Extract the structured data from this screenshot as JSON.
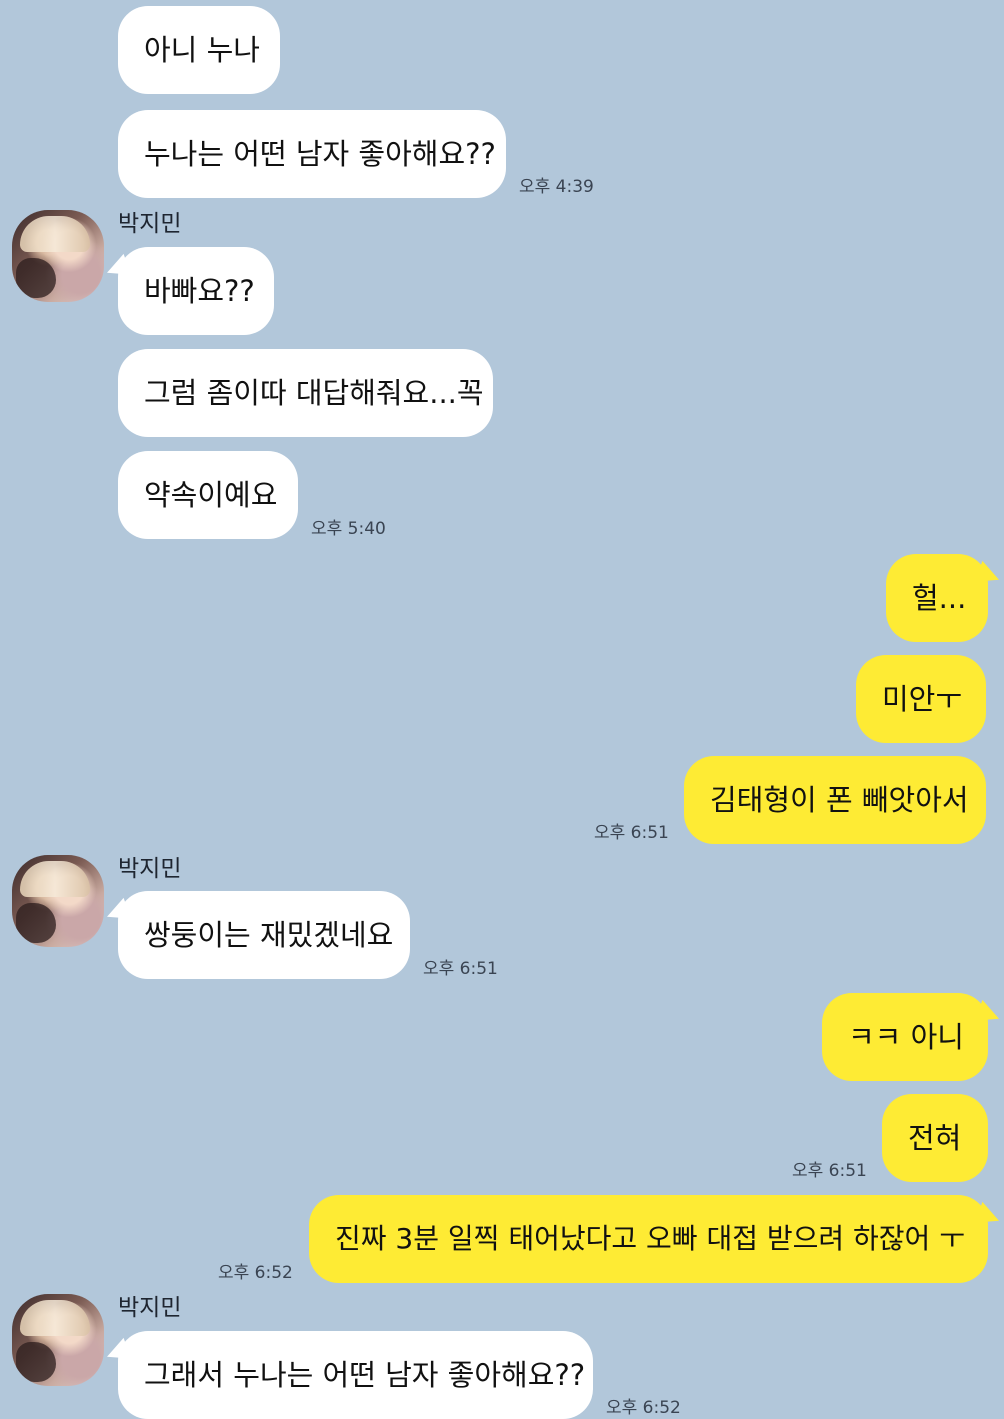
{
  "sender_name": "박지민",
  "colors": {
    "background": "#B2C7DA",
    "incoming_bubble": "#FFFFFF",
    "outgoing_bubble": "#FEEB34"
  },
  "messages": [
    {
      "text": "아니 누나",
      "time": ""
    },
    {
      "text": "누나는 어떤 남자 좋아해요??",
      "time": "오후 4:39"
    },
    {
      "text": "바빠요??",
      "time": ""
    },
    {
      "text": "그럼 좀이따 대답해줘요...꼭",
      "time": ""
    },
    {
      "text": "약속이예요",
      "time": "오후 5:40"
    },
    {
      "text": "헐...",
      "time": ""
    },
    {
      "text": "미안ㅜ",
      "time": ""
    },
    {
      "text": "김태형이 폰 빼앗아서",
      "time": "오후 6:51"
    },
    {
      "text": "쌍둥이는 재밌겠네요",
      "time": "오후 6:51"
    },
    {
      "text": "ㅋㅋ 아니",
      "time": ""
    },
    {
      "text": "전혀",
      "time": "오후 6:51"
    },
    {
      "text": "진짜 3분 일찍 태어났다고 오빠 대접 받으려 하잖어 ㅜ",
      "time": "오후 6:52"
    },
    {
      "text": "그래서 누나는 어떤 남자 좋아해요??",
      "time": "오후 6:52"
    }
  ]
}
